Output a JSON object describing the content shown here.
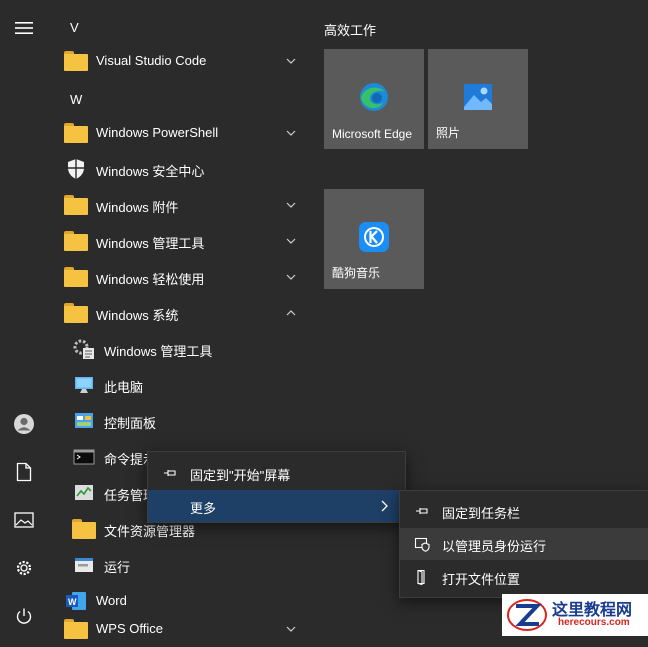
{
  "rail": {
    "icons": [
      "hamburger-menu-icon",
      "user-account-icon",
      "documents-icon",
      "pictures-icon",
      "settings-gear-icon",
      "power-icon"
    ]
  },
  "app_list": {
    "sections": [
      {
        "letter": "V"
      },
      {
        "letter": "W"
      }
    ],
    "items": [
      {
        "label": "Visual Studio Code",
        "icon": "folder-icon",
        "expander": "chevron-down"
      },
      {
        "label": "Windows PowerShell",
        "icon": "folder-icon",
        "expander": "chevron-down"
      },
      {
        "label": "Windows 安全中心",
        "icon": "shield-icon",
        "expander": ""
      },
      {
        "label": "Windows 附件",
        "icon": "folder-icon",
        "expander": "chevron-down"
      },
      {
        "label": "Windows 管理工具",
        "icon": "folder-icon",
        "expander": "chevron-down"
      },
      {
        "label": "Windows 轻松使用",
        "icon": "folder-icon",
        "expander": "chevron-down"
      },
      {
        "label": "Windows 系统",
        "icon": "folder-icon",
        "expander": "chevron-up"
      },
      {
        "label": "Windows 管理工具",
        "icon": "admin-tools-icon"
      },
      {
        "label": "此电脑",
        "icon": "this-pc-icon"
      },
      {
        "label": "控制面板",
        "icon": "control-panel-icon"
      },
      {
        "label": "命令提示",
        "icon": "command-prompt-icon"
      },
      {
        "label": "任务管理",
        "icon": "task-manager-icon"
      },
      {
        "label": "文件资源管理器",
        "icon": "file-explorer-icon"
      },
      {
        "label": "运行",
        "icon": "run-icon"
      },
      {
        "label": "Word",
        "icon": "word-icon",
        "expander": ""
      },
      {
        "label": "WPS Office",
        "icon": "folder-icon",
        "expander": "chevron-down"
      }
    ]
  },
  "tiles": {
    "group_title": "高效工作",
    "items": [
      {
        "label": "Microsoft Edge",
        "icon": "edge-icon"
      },
      {
        "label": "照片",
        "icon": "photos-icon"
      },
      {
        "label": "酷狗音乐",
        "icon": "kugou-music-icon"
      }
    ]
  },
  "context_menu": {
    "items": [
      {
        "label": "固定到\"开始\"屏幕",
        "icon": "pin-icon"
      },
      {
        "label": "更多",
        "icon": "",
        "arrow": "chevron-right"
      }
    ]
  },
  "submenu": {
    "items": [
      {
        "label": "固定到任务栏",
        "icon": "pin-icon"
      },
      {
        "label": "以管理员身份运行",
        "icon": "admin-shield-icon"
      },
      {
        "label": "打开文件位置",
        "icon": "open-file-location-icon"
      }
    ]
  },
  "watermark": {
    "title": "这里教程网",
    "url": "herecours.com"
  },
  "colors": {
    "background": "#2b2b2b",
    "tile": "#5a5a5a",
    "menu_highlight": "#3b3b3b",
    "selected_item": "#1e3f66",
    "folder": "#f5c242"
  }
}
